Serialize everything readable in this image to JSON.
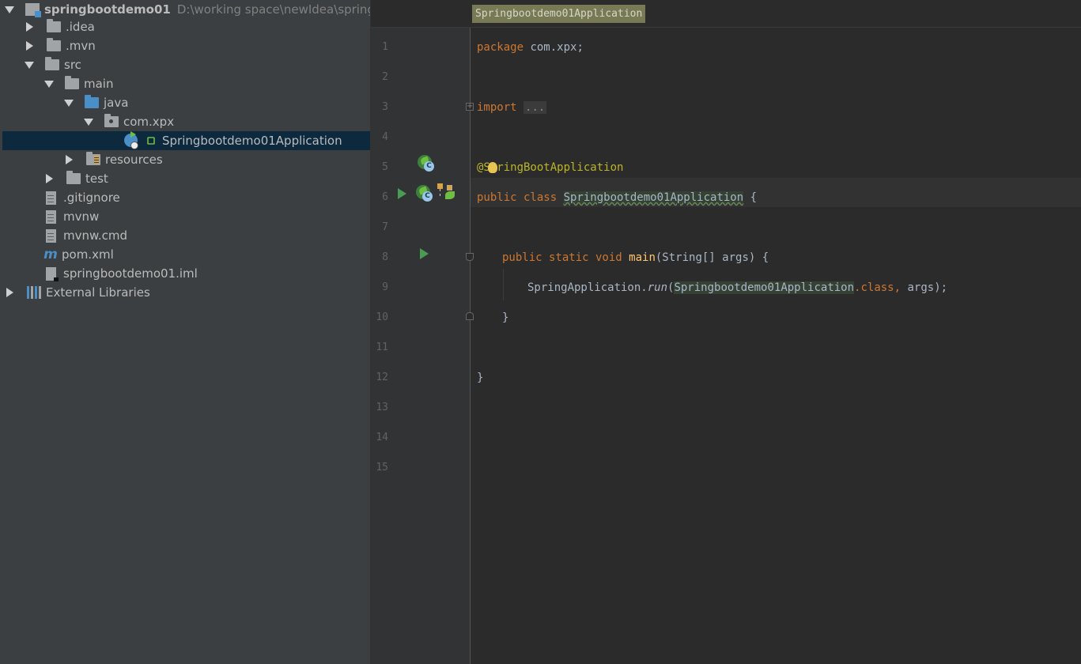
{
  "project_tree": {
    "root": {
      "name": "springbootdemo01",
      "path": "D:\\working space\\newIdea\\springbo"
    },
    "items": [
      {
        "label": ".idea"
      },
      {
        "label": ".mvn"
      },
      {
        "label": "src"
      },
      {
        "label": "main"
      },
      {
        "label": "java"
      },
      {
        "label": "com.xpx"
      },
      {
        "label": "Springbootdemo01Application"
      },
      {
        "label": "resources"
      },
      {
        "label": "test"
      },
      {
        "label": ".gitignore"
      },
      {
        "label": "mvnw"
      },
      {
        "label": "mvnw.cmd"
      },
      {
        "label": "pom.xml"
      },
      {
        "label": "springbootdemo01.iml"
      },
      {
        "label": "External Libraries"
      }
    ],
    "selected": "Springbootdemo01Application"
  },
  "editor": {
    "tab_title": "Springbootdemo01Application",
    "line_numbers": [
      "1",
      "2",
      "3",
      "4",
      "5",
      "6",
      "7",
      "8",
      "9",
      "10",
      "11",
      "12",
      "13",
      "14",
      "15"
    ],
    "code": {
      "l1_kw": "package",
      "l1_rest": " com.xpx;",
      "l3_kw": "import",
      "l3_dots": "...",
      "l6_ann": "@SpringBootApplication",
      "l7_kw": "public class ",
      "l7_name": "Springbootdemo01Application",
      "l7_rest": " {",
      "l9_kw": "public static void ",
      "l9_fn": "main",
      "l9_rest": "(String[] args) {",
      "l10_a": "SpringApplication.",
      "l10_run": "run",
      "l10_paren": "(",
      "l10_cls": "Springbootdemo01Application",
      "l10_dotclass": ".class,",
      "l10_rest": " args);",
      "l11": "}",
      "l13": "}"
    }
  },
  "icons": {
    "spring_bean": "spring-bean-icon",
    "run": "run-icon",
    "fold": "fold-icon",
    "bulb": "intention-bulb-icon"
  },
  "colors": {
    "tree_bg": "#3c3f41",
    "editor_bg": "#2b2b2b",
    "keyword": "#cc7832",
    "annotation": "#bbb529",
    "function": "#ffc66d",
    "selection": "#0d293e"
  }
}
